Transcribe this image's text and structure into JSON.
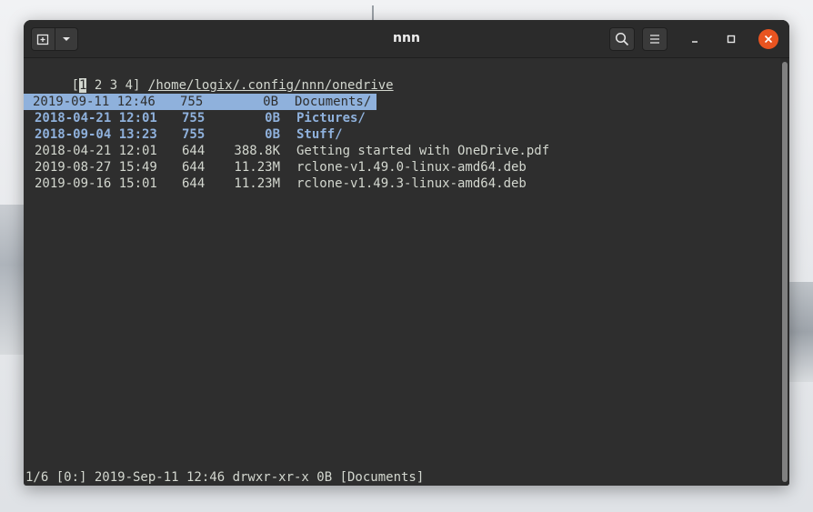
{
  "window": {
    "title": "nnn",
    "close_icon": "×"
  },
  "tabs_line": {
    "open_bracket": "[",
    "current_tab": "1",
    "other_tabs": " 2 3 4] ",
    "path": "/home/logix/.config/nnn/onedrive"
  },
  "files": [
    {
      "date": "2019-09-11 12:46",
      "perm": "755",
      "size": "0B",
      "name": "Documents/",
      "is_dir": true,
      "selected": true
    },
    {
      "date": "2018-04-21 12:01",
      "perm": "755",
      "size": "0B",
      "name": "Pictures/",
      "is_dir": true,
      "selected": false
    },
    {
      "date": "2018-09-04 13:23",
      "perm": "755",
      "size": "0B",
      "name": "Stuff/",
      "is_dir": true,
      "selected": false
    },
    {
      "date": "2018-04-21 12:01",
      "perm": "644",
      "size": "388.8K",
      "name": "Getting started with OneDrive.pdf",
      "is_dir": false,
      "selected": false
    },
    {
      "date": "2019-08-27 15:49",
      "perm": "644",
      "size": "11.23M",
      "name": "rclone-v1.49.0-linux-amd64.deb",
      "is_dir": false,
      "selected": false
    },
    {
      "date": "2019-09-16 15:01",
      "perm": "644",
      "size": "11.23M",
      "name": "rclone-v1.49.3-linux-amd64.deb",
      "is_dir": false,
      "selected": false
    }
  ],
  "status_line": "1/6 [0:] 2019-Sep-11 12:46 drwxr-xr-x 0B [Documents]",
  "colors": {
    "terminal_bg": "#2e2e2e",
    "terminal_fg": "#d3d7cf",
    "dir_blue": "#8fb1dc",
    "close_orange": "#e95420"
  }
}
